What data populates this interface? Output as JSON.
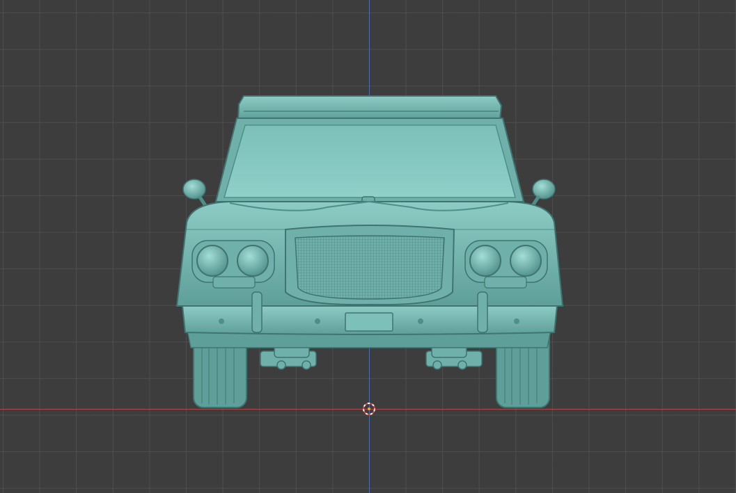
{
  "viewport": {
    "name": "3D Viewport",
    "view": "front-orthographic",
    "background_color": "#3d3d3d",
    "grid_color": "#5a5a5a",
    "axis_x_color": "#b04a4a",
    "axis_z_color": "#4a6fb0"
  },
  "model": {
    "object": "classic-sedan-front-view",
    "material_color": "#6fb5b0",
    "shade_dark": "#4f8f8a",
    "shade_light": "#8fd0c9"
  },
  "cursor": {
    "icon": "3d-cursor-icon",
    "ring_colors": [
      "#e04040",
      "#ffffff"
    ]
  }
}
